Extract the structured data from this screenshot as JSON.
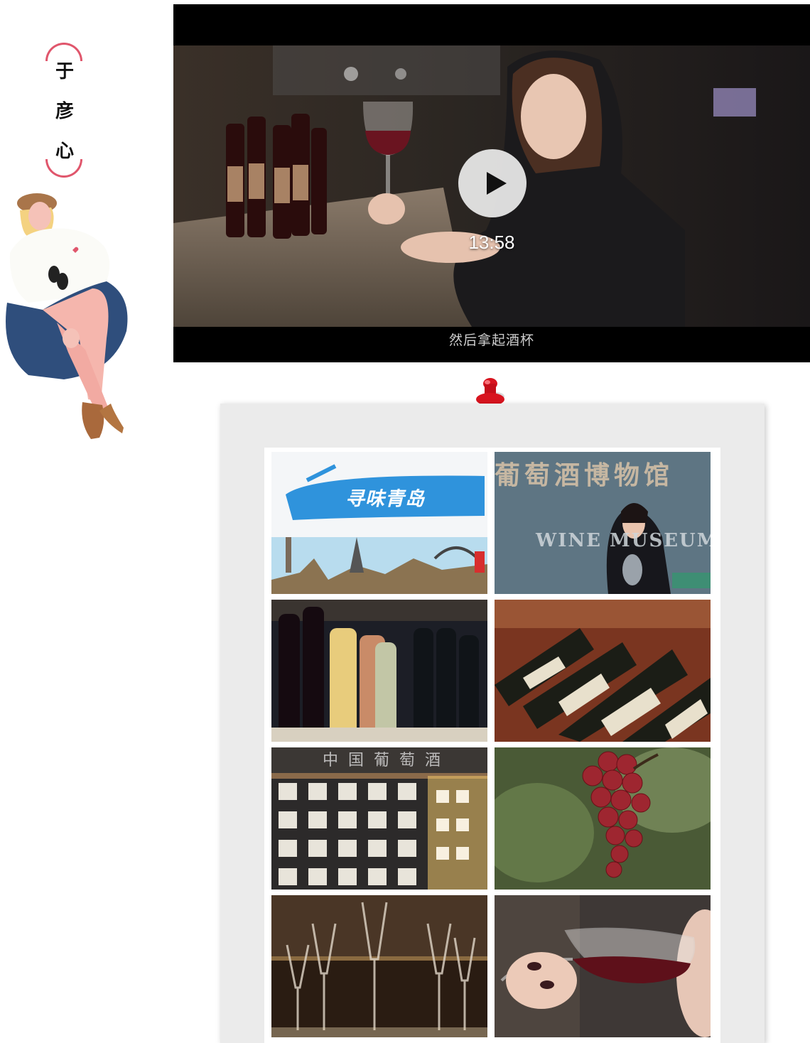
{
  "author": {
    "name_chars": [
      "于",
      "彦",
      "心"
    ],
    "accent_color": "#e0566c",
    "illustration_icon": "seated-woman-illustration"
  },
  "video": {
    "duration": "13:58",
    "subtitle": "然后拿起酒杯",
    "play_icon": "play-icon"
  },
  "pin_icon": "red-pushpin-icon",
  "gallery": {
    "photos": [
      {
        "name": "title-card-photo",
        "text": "寻味青岛"
      },
      {
        "name": "wine-museum-reporter-photo",
        "text": "葡萄酒博物馆",
        "text_en": "WINE MUSEUM"
      },
      {
        "name": "wine-bottle-shelf-photo"
      },
      {
        "name": "wine-rack-bottles-photo"
      },
      {
        "name": "wine-museum-wall-photo",
        "text": "中国葡萄酒"
      },
      {
        "name": "red-grapes-photo"
      },
      {
        "name": "champagne-glasses-photo"
      },
      {
        "name": "tasting-red-wine-photo"
      }
    ]
  }
}
